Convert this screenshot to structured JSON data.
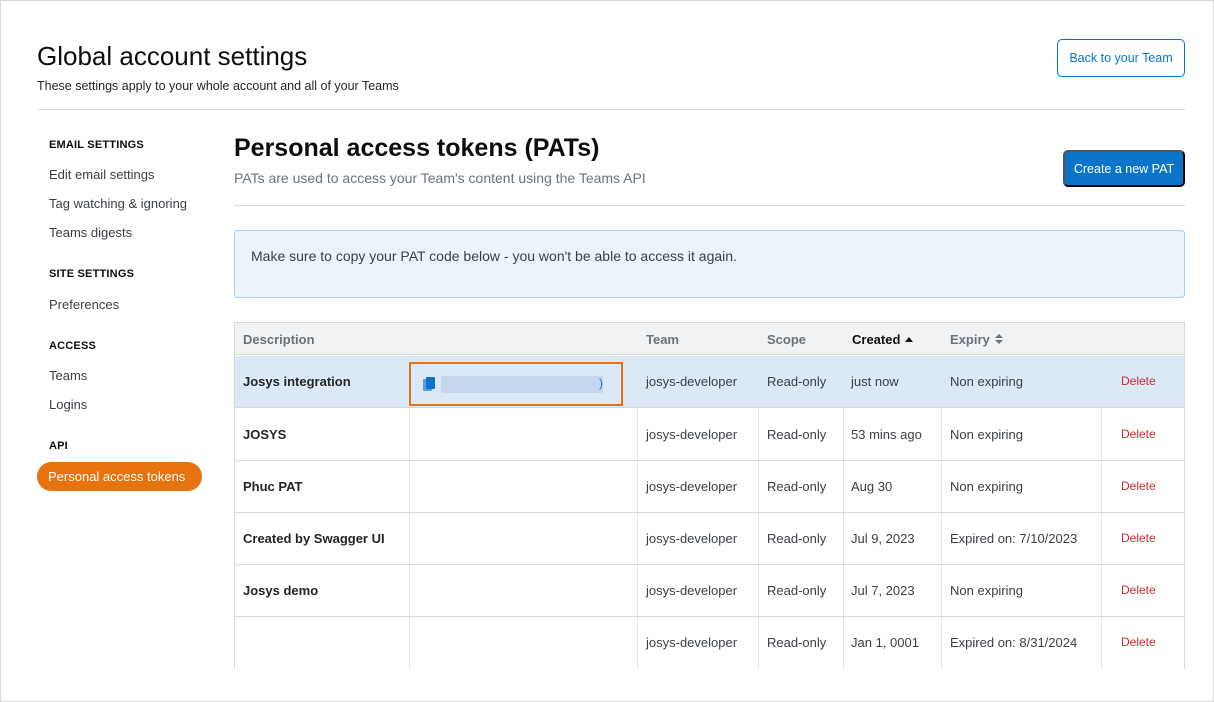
{
  "header": {
    "title": "Global account settings",
    "subtitle": "These settings apply to your whole account and all of your Teams",
    "back_button": "Back to your Team"
  },
  "sidebar": {
    "sections": [
      {
        "heading": "EMAIL SETTINGS",
        "items": [
          "Edit email settings",
          "Tag watching & ignoring",
          "Teams digests"
        ]
      },
      {
        "heading": "SITE SETTINGS",
        "items": [
          "Preferences"
        ]
      },
      {
        "heading": "ACCESS",
        "items": [
          "Teams",
          "Logins"
        ]
      },
      {
        "heading": "API",
        "items": [
          "Personal access tokens"
        ]
      }
    ],
    "active_item": "Personal access tokens",
    "active_color": "#e8720c"
  },
  "main": {
    "title": "Personal access tokens (PATs)",
    "subtitle": "PATs are used to access your Team's content using the Teams API",
    "create_button": "Create a new PAT",
    "alert": "Make sure to copy your PAT code below - you won't be able to access it again."
  },
  "table": {
    "columns": {
      "description": "Description",
      "team": "Team",
      "scope": "Scope",
      "created": "Created",
      "expiry": "Expiry"
    },
    "sort": {
      "column": "Created",
      "direction": "ascending"
    },
    "token_suffix": ")",
    "rows": [
      {
        "description": "Josys integration",
        "team": "josys-developer",
        "scope": "Read-only",
        "created": "just now",
        "expiry": "Non expiring",
        "action": "Delete"
      },
      {
        "description": "JOSYS",
        "team": "josys-developer",
        "scope": "Read-only",
        "created": "53 mins ago",
        "expiry": "Non expiring",
        "action": "Delete"
      },
      {
        "description": "Phuc PAT",
        "team": "josys-developer",
        "scope": "Read-only",
        "created": "Aug 30",
        "expiry": "Non expiring",
        "action": "Delete"
      },
      {
        "description": "Created by Swagger UI",
        "team": "josys-developer",
        "scope": "Read-only",
        "created": "Jul 9, 2023",
        "expiry": "Expired on: 7/10/2023",
        "action": "Delete"
      },
      {
        "description": "Josys demo",
        "team": "josys-developer",
        "scope": "Read-only",
        "created": "Jul 7, 2023",
        "expiry": "Non expiring",
        "action": "Delete"
      },
      {
        "description": "",
        "team": "josys-developer",
        "scope": "Read-only",
        "created": "Jan 1, 0001",
        "expiry": "Expired on: 8/31/2024",
        "action": "Delete"
      }
    ]
  },
  "colors": {
    "primary": "#0a74c9",
    "danger": "#c22e32",
    "highlight_row": "#dbe8f6",
    "alert_bg": "#ebf4fb"
  },
  "icons": {
    "copy": "copy-icon",
    "sort_asc": "sort-ascending-icon",
    "sort_both": "sort-both-icon"
  }
}
